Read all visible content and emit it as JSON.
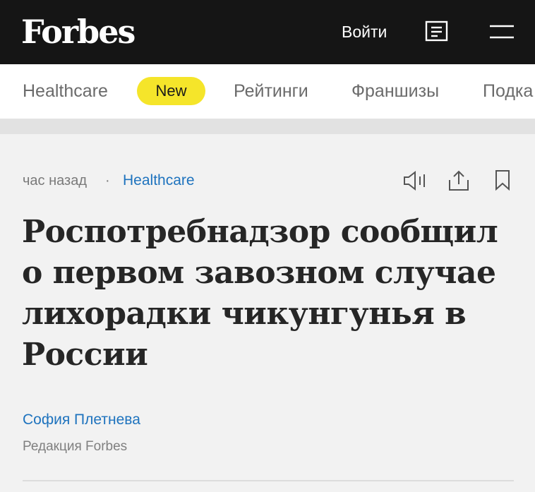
{
  "header": {
    "logo": "Forbes",
    "login_label": "Войти",
    "icons": [
      "search-icon",
      "menu-icon"
    ]
  },
  "categories": {
    "items": [
      "Healthcare",
      "New",
      "Рейтинги",
      "Франшизы",
      "Подка"
    ]
  },
  "article": {
    "time": "час назад",
    "separator": "·",
    "category": "Healthcare",
    "actions": [
      "listen-icon",
      "share-icon",
      "bookmark-icon"
    ],
    "title": "Роспотребнадзор сообщил о первом завозном случае лихорадки чикунгунья в России",
    "author": "София Плетнева",
    "author_role": "Редакция Forbes"
  },
  "colors": {
    "topbar": "#151515",
    "accent_yellow": "#f5e52a",
    "link_blue": "#1e73be",
    "background": "#f2f2f2"
  }
}
